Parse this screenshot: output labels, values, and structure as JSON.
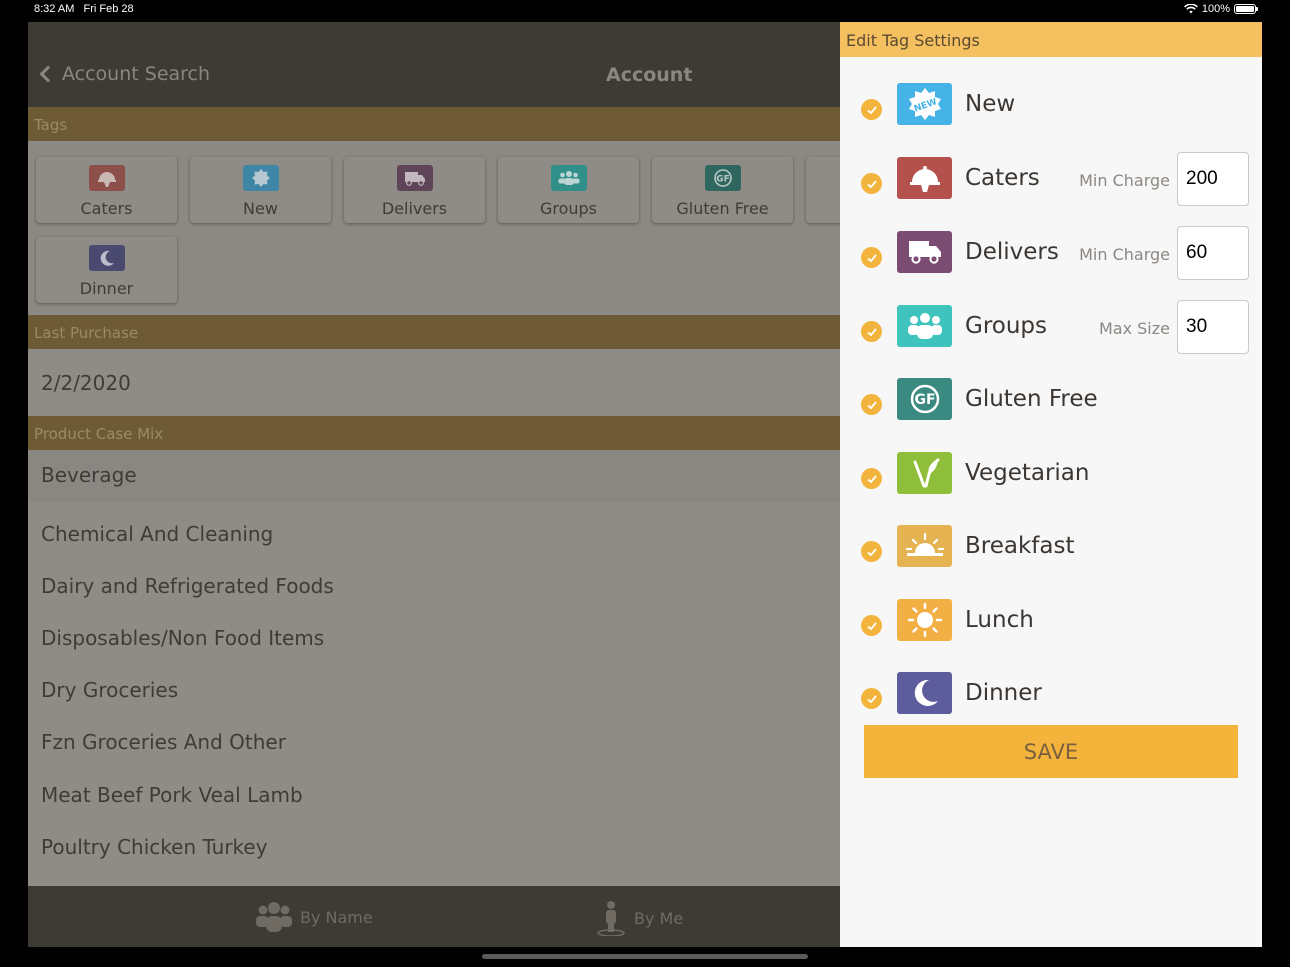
{
  "status_bar": {
    "time": "8:32 AM",
    "date": "Fri Feb 28",
    "battery": "100%"
  },
  "nav": {
    "back_label": "Account Search",
    "title": "Account"
  },
  "sections": {
    "tags": "Tags",
    "last_purchase": "Last Purchase",
    "product_case_mix": "Product Case Mix"
  },
  "tags_grid": [
    {
      "label": "Caters",
      "icon": "caters-icon",
      "color": "#8c4f4a"
    },
    {
      "label": "New",
      "icon": "new-icon",
      "color": "#3e85a6"
    },
    {
      "label": "Delivers",
      "icon": "delivers-icon",
      "color": "#5f4558"
    },
    {
      "label": "Groups",
      "icon": "groups-icon",
      "color": "#318f8a"
    },
    {
      "label": "Gluten Free",
      "icon": "gluten-free-icon",
      "color": "#2f6660"
    },
    {
      "label": "Dinner",
      "icon": "dinner-icon",
      "color": "#4a4970"
    }
  ],
  "last_purchase": "2/2/2020",
  "product_case_mix": [
    "Beverage",
    "Chemical And Cleaning",
    "Dairy and Refrigerated Foods",
    "Disposables/Non Food Items",
    "Dry Groceries",
    "Fzn Groceries And Other",
    "Meat Beef Pork Veal Lamb",
    "Poultry Chicken Turkey"
  ],
  "tabs": {
    "by_name": "By Name",
    "by_me": "By Me"
  },
  "panel": {
    "title": "Edit Tag Settings",
    "save_label": "SAVE",
    "tags": [
      {
        "name": "New",
        "icon": "new-badge-icon",
        "color": "#45b3e6",
        "checked": true
      },
      {
        "name": "Caters",
        "icon": "serving-cloche-icon",
        "color": "#b5514c",
        "checked": true,
        "field_label": "Min Charge",
        "field_value": "200"
      },
      {
        "name": "Delivers",
        "icon": "delivery-truck-icon",
        "color": "#7b4c72",
        "checked": true,
        "field_label": "Min Charge",
        "field_value": "60"
      },
      {
        "name": "Groups",
        "icon": "people-group-icon",
        "color": "#3ec3bd",
        "checked": true,
        "field_label": "Max Size",
        "field_value": "30"
      },
      {
        "name": "Gluten Free",
        "icon": "gluten-free-gf-icon",
        "color": "#3a8a82",
        "checked": true
      },
      {
        "name": "Vegetarian",
        "icon": "leaf-sprout-icon",
        "color": "#8fbf3a",
        "checked": true
      },
      {
        "name": "Breakfast",
        "icon": "sunrise-icon",
        "color": "#e6b352",
        "checked": true
      },
      {
        "name": "Lunch",
        "icon": "sun-icon",
        "color": "#f2b044",
        "checked": true
      },
      {
        "name": "Dinner",
        "icon": "moon-icon",
        "color": "#5d5c9c",
        "checked": true
      }
    ]
  }
}
